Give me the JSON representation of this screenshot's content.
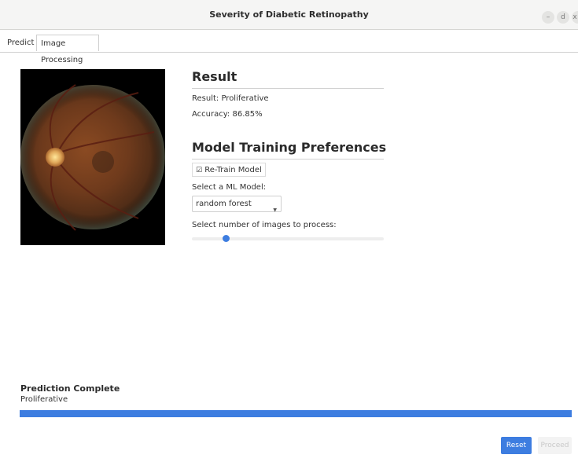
{
  "window": {
    "title": "Severity of Diabetic Retinopathy",
    "controls": {
      "minimize": "–",
      "maximize": "d",
      "close": "x"
    }
  },
  "tabs": [
    {
      "label": "Predict",
      "active": true
    },
    {
      "label": "Image Processing",
      "active": false
    }
  ],
  "image": {
    "icon": "retina-fundus-image"
  },
  "result": {
    "heading": "Result",
    "result_line": "Result: Proliferative",
    "accuracy_line": "Accuracy: 86.85%"
  },
  "preferences": {
    "heading": "Model Training Preferences",
    "retrain_label": "Re-Train Model",
    "retrain_checked": true,
    "model_prompt": "Select a ML Model:",
    "model_value": "random forest",
    "images_prompt": "Select number of images to process:",
    "images_slider_fraction": 0.18
  },
  "status": {
    "title": "Prediction Complete",
    "subtitle": "Proliferative",
    "progress_fraction": 1.0
  },
  "buttons": {
    "reset": "Reset",
    "proceed": "Proceed"
  },
  "colors": {
    "accent": "#3d7de0"
  }
}
